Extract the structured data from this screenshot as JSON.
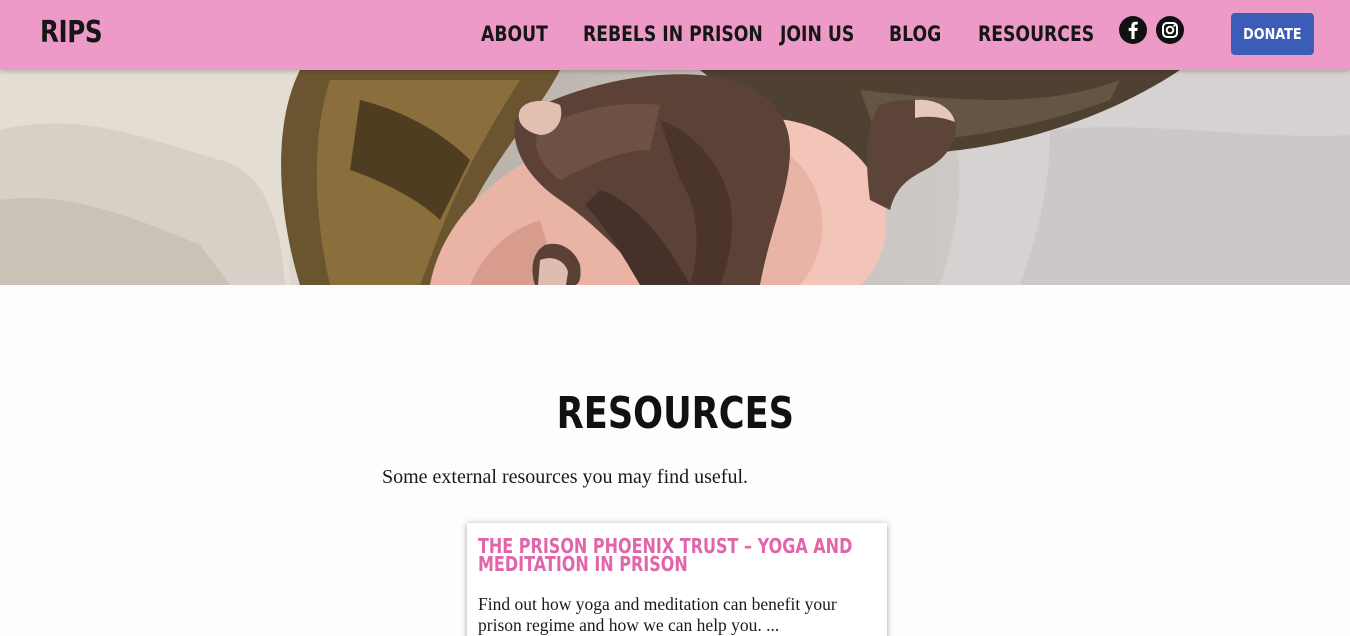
{
  "header": {
    "logo": "RIPS",
    "nav": [
      {
        "label": "ABOUT"
      },
      {
        "label": "REBELS IN PRISON"
      },
      {
        "label": "JOIN US"
      },
      {
        "label": "BLOG"
      },
      {
        "label": "RESOURCES"
      }
    ],
    "social": [
      {
        "name": "facebook-icon"
      },
      {
        "name": "instagram-icon"
      }
    ],
    "donate_label": "DONATE"
  },
  "hero": {
    "image": "hands-holding-image"
  },
  "main": {
    "title": "RESOURCES",
    "intro": "Some external resources you may find useful."
  },
  "resources": [
    {
      "title": "THE PRISON PHOENIX TRUST – YOGA AND MEDITATION IN PRISON",
      "description": "Find out how yoga and meditation can benefit your prison regime and how we can help you. ..."
    }
  ],
  "colors": {
    "nav_bg": "#ee9ac8",
    "donate_bg": "#3b5db8",
    "card_title": "#e165ab",
    "text": "#1a1a1a"
  }
}
